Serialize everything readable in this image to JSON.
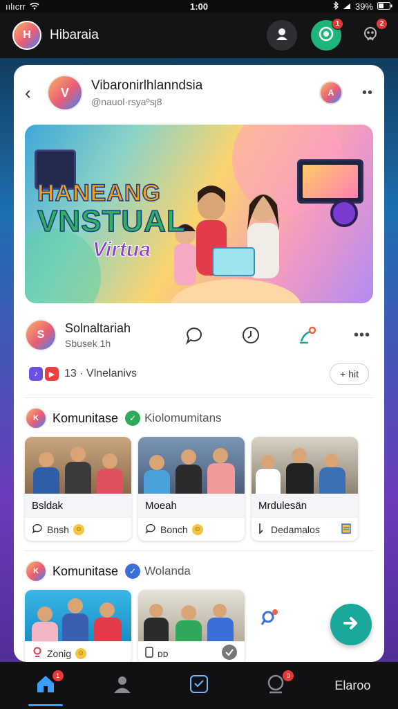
{
  "status_bar": {
    "carrier": "ıılıcrr",
    "time": "1:00",
    "battery": "39%"
  },
  "app_header": {
    "title": "Hibaraia",
    "avatar_initials": "H",
    "notifications_badge": "1",
    "alerts_badge": "2"
  },
  "profile": {
    "name": "Vibaronirlhlanndsia",
    "handle": "@nauol·rsyaºsȷ8",
    "avatar_initials": "V",
    "mini_avatar_initials": "A"
  },
  "banner": {
    "line1": "HANEANG",
    "line2": "VNSTUAL",
    "line3": "Virtua"
  },
  "post": {
    "author_name": "Solnaltariah",
    "author_sub": "Sbusek 1h",
    "author_initials": "S",
    "reaction_count": "13 · Vlnelanivs",
    "pill_label": "hit",
    "reaction_chip_1": "♪",
    "reaction_chip_2": "▶"
  },
  "community_1": {
    "title": "Komunitase",
    "subtitle": "Kiolomumitans",
    "avatar_initials": "K",
    "check_color": "#2fa85b",
    "tiles": [
      {
        "label": "Bsldak",
        "foot": "Bnsh"
      },
      {
        "label": "Moeah",
        "foot": "Bonch"
      },
      {
        "label": "Mrdulesän",
        "foot": "Dedamalos"
      }
    ]
  },
  "community_2": {
    "title": "Komunitase",
    "subtitle": "Wolanda",
    "avatar_initials": "K",
    "check_color": "#3a6fd8",
    "tiles": [
      {
        "foot": "Zonig"
      },
      {
        "foot": "ᴅᴅ"
      }
    ]
  },
  "bottom_nav": {
    "home_badge": "1",
    "chat_badge": "0",
    "more_label": "Elaroo"
  },
  "colors": {
    "accent": "#19a89a",
    "brand_blue": "#3aa0ff",
    "badge_red": "#e53935"
  }
}
